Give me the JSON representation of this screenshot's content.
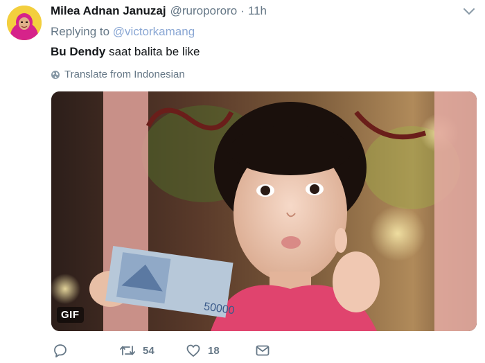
{
  "tweet": {
    "display_name": "Milea Adnan Januzaj",
    "handle": "@ruropororo",
    "separator": "·",
    "timestamp": "11h",
    "replying_prefix": "Replying to",
    "replying_to": "@victorkamang",
    "text_bold": "Bu Dendy",
    "text_rest": " saat balita be like",
    "translate_label": "Translate from Indonesian",
    "media": {
      "badge": "GIF",
      "banknote_value": "50000"
    },
    "actions": {
      "reply_icon": "reply-icon",
      "retweet_icon": "retweet-icon",
      "retweet_count": "54",
      "like_icon": "heart-icon",
      "like_count": "18",
      "dm_icon": "envelope-icon"
    }
  },
  "colors": {
    "text_primary": "#14171a",
    "text_secondary": "#657786",
    "mention": "#8aa7d4",
    "icon_gray": "#657786"
  }
}
